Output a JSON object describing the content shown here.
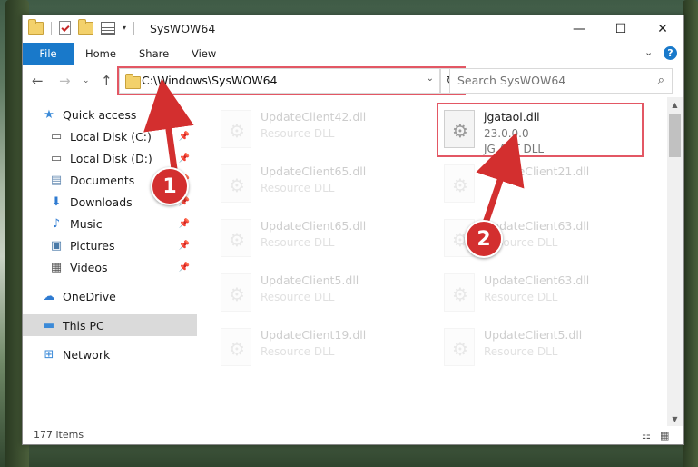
{
  "window": {
    "title": "SysWOW64",
    "controls": {
      "minimize": "—",
      "maximize": "☐",
      "close": "✕"
    }
  },
  "ribbon": {
    "tabs": [
      "File",
      "Home",
      "Share",
      "View"
    ],
    "help": "?"
  },
  "address_bar": {
    "path": "C:\\Windows\\SysWOW64",
    "search_placeholder": "Search SysWOW64"
  },
  "sidebar": {
    "items": [
      {
        "label": "Quick access",
        "icon": "star-icon",
        "pinned": false
      },
      {
        "label": "Local Disk (C:)",
        "icon": "drive-icon",
        "pinned": true
      },
      {
        "label": "Local Disk (D:)",
        "icon": "drive-icon",
        "pinned": true
      },
      {
        "label": "Documents",
        "icon": "documents-icon",
        "pinned": true
      },
      {
        "label": "Downloads",
        "icon": "download-icon",
        "pinned": true
      },
      {
        "label": "Music",
        "icon": "music-icon",
        "pinned": true
      },
      {
        "label": "Pictures",
        "icon": "pictures-icon",
        "pinned": true
      },
      {
        "label": "Videos",
        "icon": "videos-icon",
        "pinned": true
      },
      {
        "label": "OneDrive",
        "icon": "cloud-icon",
        "pinned": false
      },
      {
        "label": "This PC",
        "icon": "pc-icon",
        "pinned": false,
        "selected": true
      },
      {
        "label": "Network",
        "icon": "network-icon",
        "pinned": false
      }
    ]
  },
  "files": [
    {
      "name": "UpdateClient42.dll",
      "line2": "Resource DLL",
      "line3": ""
    },
    {
      "name": "jgataol.dll",
      "line2": "23.0.0.0",
      "line3": "JG ART DLL"
    },
    {
      "name": "UpdateClient65.dll",
      "line2": "Resource DLL",
      "line3": ""
    },
    {
      "name": "UpdateClient21.dll",
      "line2": "",
      "line3": ""
    },
    {
      "name": "UpdateClient65.dll",
      "line2": "Resource DLL",
      "line3": ""
    },
    {
      "name": "UpdateClient63.dll",
      "line2": "Resource DLL",
      "line3": ""
    },
    {
      "name": "UpdateClient5.dll",
      "line2": "Resource DLL",
      "line3": ""
    },
    {
      "name": "UpdateClient63.dll",
      "line2": "Resource DLL",
      "line3": ""
    },
    {
      "name": "UpdateClient19.dll",
      "line2": "Resource DLL",
      "line3": ""
    },
    {
      "name": "UpdateClient5.dll",
      "line2": "Resource DLL",
      "line3": ""
    }
  ],
  "status": {
    "item_count": "177 items"
  },
  "callouts": [
    "1",
    "2"
  ],
  "colors": {
    "accent": "#1979ca",
    "callout": "#d32f2f",
    "highlight_box": "#e35764"
  }
}
